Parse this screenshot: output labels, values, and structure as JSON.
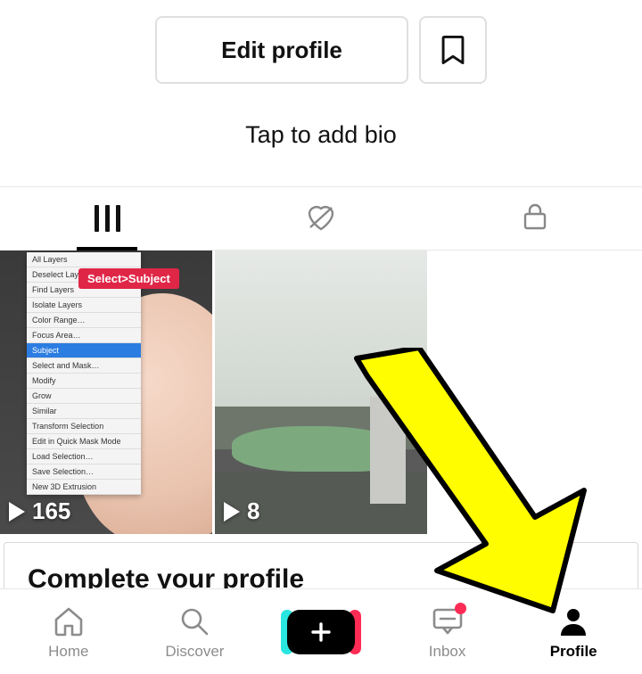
{
  "top": {
    "edit_label": "Edit profile",
    "bio_prompt": "Tap to add bio"
  },
  "videos": [
    {
      "views": "165",
      "badge": "Select>Subject"
    },
    {
      "views": "8"
    }
  ],
  "card": {
    "title": "Complete your profile"
  },
  "tabbar": {
    "home": "Home",
    "discover": "Discover",
    "inbox": "Inbox",
    "profile": "Profile"
  }
}
